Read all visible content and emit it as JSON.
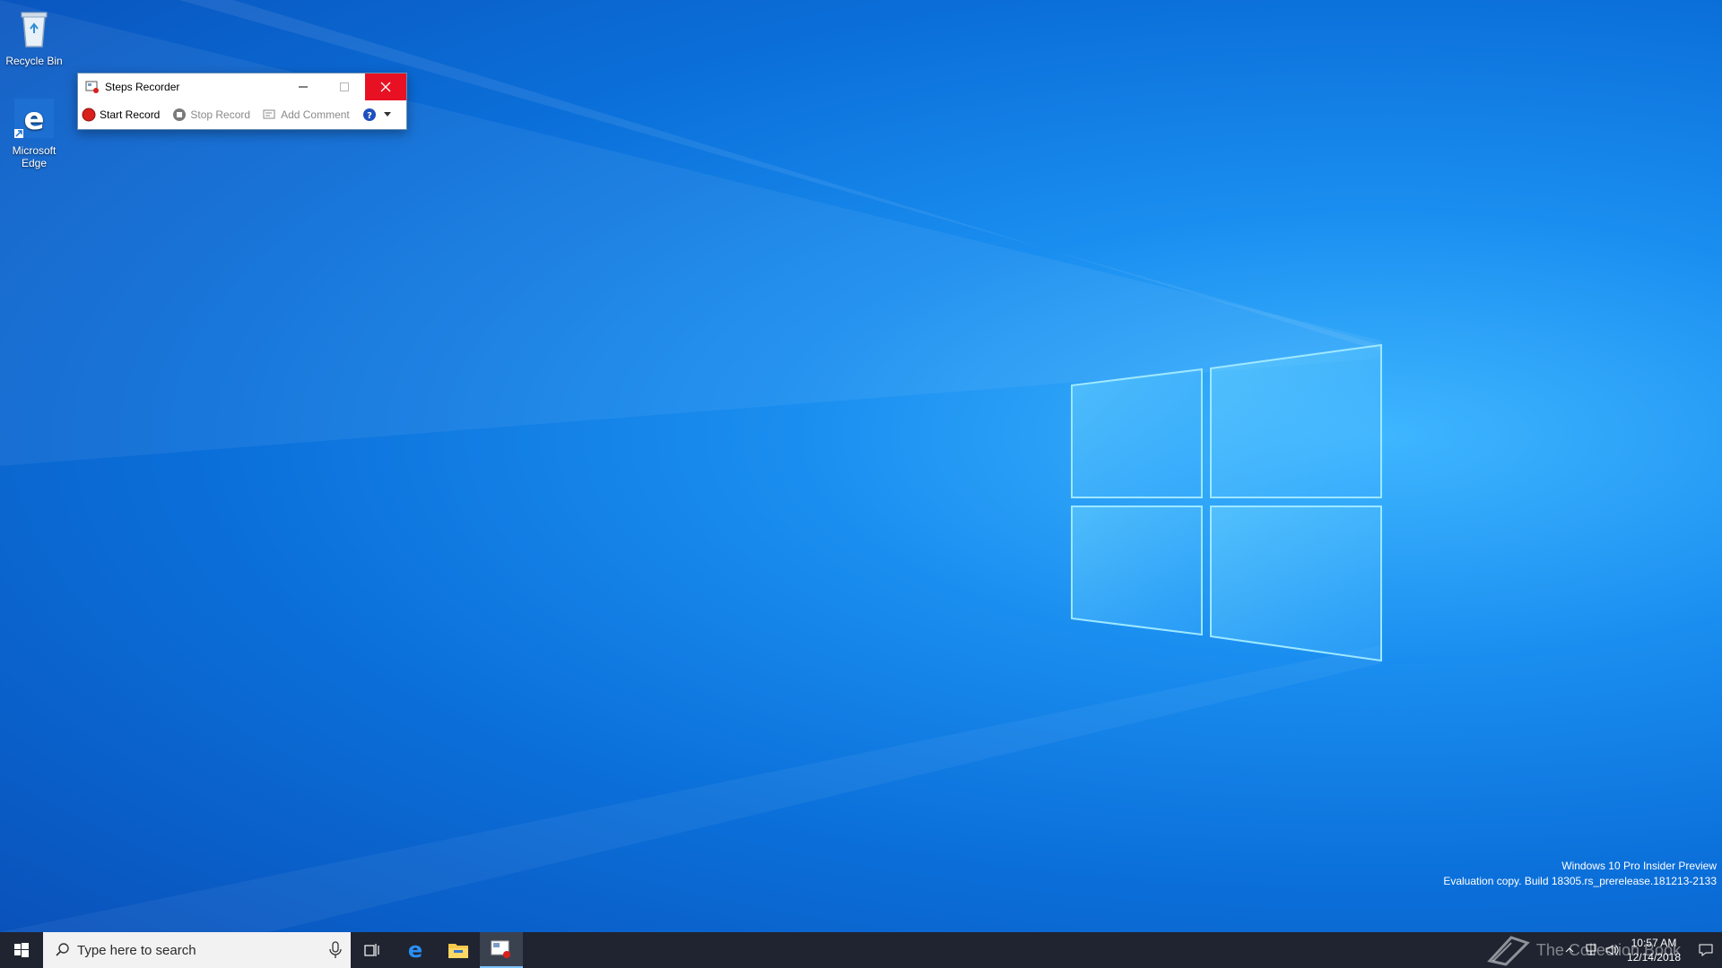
{
  "desktop": {
    "icons": [
      {
        "label": "Recycle Bin"
      },
      {
        "label": "Microsoft Edge"
      }
    ]
  },
  "steps_recorder": {
    "title": "Steps Recorder",
    "start_record": "Start Record",
    "stop_record": "Stop Record",
    "add_comment": "Add Comment"
  },
  "watermark": {
    "line1": "Windows 10 Pro Insider Preview",
    "line2": "Evaluation copy. Build 18305.rs_prerelease.181213-2133"
  },
  "taskbar": {
    "search_placeholder": "Type here to search",
    "time": "10:57 AM",
    "date": "12/14/2018",
    "brand_watermark": "The Collection Book"
  },
  "colors": {
    "close_red": "#e81123",
    "record_red": "#d9201c",
    "taskbar_bg": "#1f2430"
  }
}
